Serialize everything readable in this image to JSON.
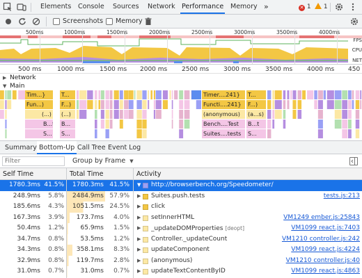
{
  "tabs": {
    "items": [
      "Elements",
      "Console",
      "Sources",
      "Network",
      "Performance",
      "Memory"
    ],
    "active": "Performance",
    "more": "»",
    "errors": "1",
    "warnings": "1"
  },
  "toolbar": {
    "screenshots_label": "Screenshots",
    "memory_label": "Memory"
  },
  "overview": {
    "ticks": [
      "500ms",
      "1000ms",
      "1500ms",
      "2000ms",
      "2500ms",
      "3000ms",
      "3500ms",
      "4000ms"
    ],
    "fps_label": "FPS",
    "cpu_label": "CPU",
    "net_label": "NET"
  },
  "ruler": {
    "ticks": [
      "500 ms",
      "1000 ms",
      "1500 ms",
      "2000 ms",
      "2500 ms",
      "3000 ms",
      "3500 ms",
      "4000 ms",
      "450"
    ]
  },
  "tracks": {
    "network": "Network",
    "main": "Main"
  },
  "flame": {
    "col1": [
      "Tim...}",
      "Fun...)",
      "(...)",
      "B...t",
      "S..."
    ],
    "col2": [
      "T...",
      "F...)",
      "(...)",
      "B...",
      "S..."
    ],
    "col3": [
      "Timer....241}",
      "Functi....241}",
      "(anonymous)",
      "Bench....Test",
      "Suites....tests"
    ],
    "col4": [
      "T...",
      "F...)",
      "(a...s)",
      "B...t",
      "S..."
    ]
  },
  "colors": {
    "accent": "#1a73e8",
    "scripting": "#f3c744",
    "scripting_light": "#fce8a4",
    "rendering": "#b58ee0",
    "painting": "#6fc26b",
    "selected_row": "#1a73e8",
    "link": "#1558d6"
  },
  "subtabs": {
    "items": [
      "Summary",
      "Bottom-Up",
      "Call Tree",
      "Event Log"
    ],
    "active": "Bottom-Up"
  },
  "filter": {
    "placeholder": "Filter",
    "group_by": "Group by Frame"
  },
  "table": {
    "headers": {
      "self_time": "Self Time",
      "total_time": "Total Time",
      "activity": "Activity"
    },
    "rows": [
      {
        "self_ms": "1780.3ms",
        "self_pct": "41.5%",
        "total_ms": "1780.3ms",
        "total_pct": "41.5%",
        "total_frac": 0.415,
        "name": "http://browserbench.org/Speedometer/",
        "tag": "",
        "link": "",
        "color": "#9aa0f5",
        "expanded": true,
        "selected": true
      },
      {
        "self_ms": "248.9ms",
        "self_pct": "5.8%",
        "total_ms": "2484.9ms",
        "total_pct": "57.9%",
        "total_frac": 0.579,
        "name": "Suites.push.tests",
        "tag": "",
        "link": "tests.js:213",
        "color": "#f3c744",
        "expanded": false,
        "selected": false
      },
      {
        "self_ms": "185.6ms",
        "self_pct": "4.3%",
        "total_ms": "1051.5ms",
        "total_pct": "24.5%",
        "total_frac": 0.245,
        "name": "click",
        "tag": "",
        "link": "",
        "color": "#f3c744",
        "expanded": false,
        "selected": false
      },
      {
        "self_ms": "167.3ms",
        "self_pct": "3.9%",
        "total_ms": "173.7ms",
        "total_pct": "4.0%",
        "total_frac": 0.04,
        "name": "setInnerHTML",
        "tag": "",
        "link": "VM1249 ember.js:25843",
        "color": "#fce8a4",
        "expanded": false,
        "selected": false
      },
      {
        "self_ms": "50.4ms",
        "self_pct": "1.2%",
        "total_ms": "65.9ms",
        "total_pct": "1.5%",
        "total_frac": 0.015,
        "name": "_updateDOMProperties",
        "tag": "[deopt]",
        "link": "VM1099 react.js:7403",
        "color": "#fce8a4",
        "expanded": false,
        "selected": false
      },
      {
        "self_ms": "34.7ms",
        "self_pct": "0.8%",
        "total_ms": "53.5ms",
        "total_pct": "1.2%",
        "total_frac": 0.012,
        "name": "Controller._updateCount",
        "tag": "",
        "link": "VM1210 controller.js:242",
        "color": "#fce8a4",
        "expanded": false,
        "selected": false
      },
      {
        "self_ms": "34.3ms",
        "self_pct": "0.8%",
        "total_ms": "358.1ms",
        "total_pct": "8.3%",
        "total_frac": 0.083,
        "name": "updateComponent",
        "tag": "",
        "link": "VM1099 react.js:4224",
        "color": "#fce8a4",
        "expanded": false,
        "selected": false
      },
      {
        "self_ms": "32.9ms",
        "self_pct": "0.8%",
        "total_ms": "119.7ms",
        "total_pct": "2.8%",
        "total_frac": 0.028,
        "name": "(anonymous)",
        "tag": "",
        "link": "VM1210 controller.js:40",
        "color": "#fce8a4",
        "expanded": false,
        "selected": false
      },
      {
        "self_ms": "31.0ms",
        "self_pct": "0.7%",
        "total_ms": "31.0ms",
        "total_pct": "0.7%",
        "total_frac": 0.007,
        "name": "updateTextContentByID",
        "tag": "",
        "link": "VM1099 react.js:4863",
        "color": "#fce8a4",
        "expanded": false,
        "selected": false
      }
    ]
  }
}
